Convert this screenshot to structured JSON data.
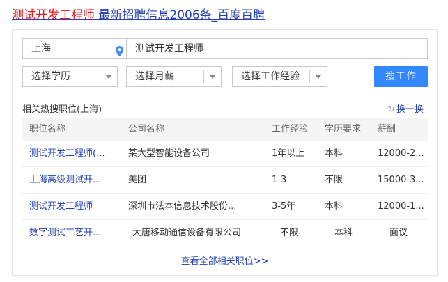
{
  "headline": {
    "highlight": "测试开发工程师",
    "rest": " 最新招聘信息2006条_百度百聘"
  },
  "search": {
    "location": "上海",
    "keyword": "测试开发工程师",
    "education_select": "选择学历",
    "salary_select": "选择月薪",
    "experience_select": "选择工作经验",
    "search_button": "搜工作"
  },
  "related": {
    "title": "相关热搜职位(上海)",
    "refresh_label": "换一换",
    "headers": {
      "position": "职位名称",
      "company": "公司名称",
      "experience": "工作经验",
      "education": "学历要求",
      "salary": "薪酬"
    },
    "rows": [
      {
        "position": "测试开发工程师(...",
        "company": "某大型智能设备公司",
        "experience": "1年以上",
        "education": "本科",
        "salary": "12000-2..."
      },
      {
        "position": "上海高级测试开...",
        "company": "美团",
        "experience": "1-3",
        "education": "不限",
        "salary": "15000-3..."
      },
      {
        "position": "测试开发工程师",
        "company": "深圳市法本信息技术股份...",
        "experience": "3-5年",
        "education": "本科",
        "salary": "12000-1..."
      },
      {
        "position": "数字测试工艺开...",
        "company": "大唐移动通信设备有限公司",
        "experience": "不限",
        "education": "本科",
        "salary": "面议"
      }
    ],
    "see_all": "查看全部相关职位>>"
  },
  "icons": {
    "location": "map-pin-icon",
    "dropdown": "chevron-down-icon",
    "refresh": "refresh-icon"
  },
  "colors": {
    "highlight": "#e41c1c",
    "link": "#2440b3",
    "button": "#3388ff"
  }
}
